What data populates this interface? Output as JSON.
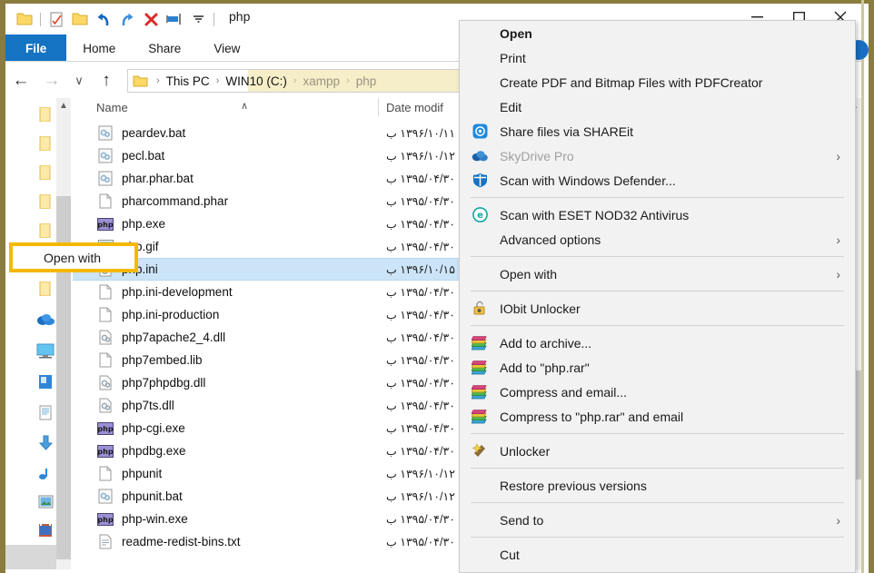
{
  "window": {
    "title": "php",
    "quick_access": [
      {
        "name": "folder-icon",
        "label": "Folder"
      },
      {
        "name": "properties-icon",
        "label": "Properties"
      },
      {
        "name": "new-folder-icon",
        "label": "New folder"
      },
      {
        "name": "undo-icon",
        "label": "Undo"
      },
      {
        "name": "redo-icon",
        "label": "Redo"
      },
      {
        "name": "delete-icon",
        "label": "Delete"
      },
      {
        "name": "rename-icon",
        "label": "Rename"
      },
      {
        "name": "customize-qat-icon",
        "label": "Customize Quick Access Toolbar"
      }
    ],
    "controls": {
      "minimize": "—",
      "maximize": "☐",
      "close": "✕"
    }
  },
  "ribbon": {
    "tabs": [
      {
        "label": "File",
        "active": true
      },
      {
        "label": "Home",
        "active": false
      },
      {
        "label": "Share",
        "active": false
      },
      {
        "label": "View",
        "active": false
      }
    ]
  },
  "address": {
    "back": "←",
    "forward": "→",
    "recent": "∨",
    "up": "↑",
    "crumbs": [
      {
        "label": "This PC",
        "dim": false
      },
      {
        "label": "WIN10 (C:)",
        "dim": false
      },
      {
        "label": "xampp",
        "dim": true
      },
      {
        "label": "php",
        "dim": true
      }
    ]
  },
  "nav_pane": {
    "items": [
      {
        "name": "folder-icon-1",
        "type": "folder"
      },
      {
        "name": "folder-icon-2",
        "type": "folder"
      },
      {
        "name": "folder-icon-3",
        "type": "folder"
      },
      {
        "name": "folder-icon-4",
        "type": "folder"
      },
      {
        "name": "folder-icon-5",
        "type": "folder"
      },
      {
        "name": "folder-icon-6",
        "type": "folder"
      },
      {
        "name": "folder-icon-7",
        "type": "folder"
      },
      {
        "name": "onedrive-icon",
        "type": "onedrive"
      },
      {
        "name": "this-pc-icon",
        "type": "monitor"
      },
      {
        "name": "drive-icon",
        "type": "drive"
      },
      {
        "name": "documents-icon",
        "type": "documents"
      },
      {
        "name": "downloads-icon",
        "type": "downloads"
      },
      {
        "name": "music-icon",
        "type": "music"
      },
      {
        "name": "pictures-icon",
        "type": "pictures"
      },
      {
        "name": "videos-icon",
        "type": "videos"
      }
    ]
  },
  "file_list": {
    "columns": {
      "name": "Name",
      "date_modified": "Date modif",
      "sort_indicator": "∧"
    },
    "rows": [
      {
        "name": "peardev.bat",
        "icon": "bat",
        "date": "۱۳۹۶/۱۰/۱۱ ب",
        "selected": false
      },
      {
        "name": "pecl.bat",
        "icon": "bat",
        "date": "۱۳۹۶/۱۰/۱۲ ب",
        "selected": false
      },
      {
        "name": "phar.phar.bat",
        "icon": "bat",
        "date": "۱۳۹۵/۰۴/۳۰ ب",
        "selected": false
      },
      {
        "name": "pharcommand.phar",
        "icon": "blank",
        "date": "۱۳۹۵/۰۴/۳۰ ب",
        "selected": false
      },
      {
        "name": "php.exe",
        "icon": "php",
        "date": "۱۳۹۵/۰۴/۳۰ ب",
        "selected": false
      },
      {
        "name": "php.gif",
        "icon": "gif",
        "date": "۱۳۹۵/۰۴/۳۰ ب",
        "selected": false
      },
      {
        "name": "php.ini",
        "icon": "ini",
        "date": "۱۳۹۶/۱۰/۱۵ ب",
        "selected": true
      },
      {
        "name": "php.ini-development",
        "icon": "blank",
        "date": "۱۳۹۵/۰۴/۳۰ ب",
        "selected": false
      },
      {
        "name": "php.ini-production",
        "icon": "blank",
        "date": "۱۳۹۵/۰۴/۳۰ ب",
        "selected": false
      },
      {
        "name": "php7apache2_4.dll",
        "icon": "dll",
        "date": "۱۳۹۵/۰۴/۳۰ ب",
        "selected": false
      },
      {
        "name": "php7embed.lib",
        "icon": "blank",
        "date": "۱۳۹۵/۰۴/۳۰ ب",
        "selected": false
      },
      {
        "name": "php7phpdbg.dll",
        "icon": "dll",
        "date": "۱۳۹۵/۰۴/۳۰ ب",
        "selected": false
      },
      {
        "name": "php7ts.dll",
        "icon": "dll",
        "date": "۱۳۹۵/۰۴/۳۰ ب",
        "selected": false
      },
      {
        "name": "php-cgi.exe",
        "icon": "php",
        "date": "۱۳۹۵/۰۴/۳۰ ب",
        "selected": false
      },
      {
        "name": "phpdbg.exe",
        "icon": "php",
        "date": "۱۳۹۵/۰۴/۳۰ ب",
        "selected": false
      },
      {
        "name": "phpunit",
        "icon": "blank",
        "date": "۱۳۹۶/۱۰/۱۲ ب",
        "selected": false
      },
      {
        "name": "phpunit.bat",
        "icon": "bat",
        "date": "۱۳۹۶/۱۰/۱۲ ب",
        "selected": false
      },
      {
        "name": "php-win.exe",
        "icon": "php",
        "date": "۱۳۹۵/۰۴/۳۰ ب",
        "selected": false
      },
      {
        "name": "readme-redist-bins.txt",
        "icon": "txt",
        "date": "۱۳۹۵/۰۴/۳۰ ب",
        "selected": false
      }
    ]
  },
  "context_menu": {
    "highlighted_item": "Open with",
    "highlight_color": "#f5b800",
    "items": [
      {
        "type": "item",
        "label": "Open",
        "icon": "none",
        "bold": true,
        "arrow": false
      },
      {
        "type": "item",
        "label": "Print",
        "icon": "none",
        "bold": false,
        "arrow": false
      },
      {
        "type": "item",
        "label": "Create PDF and Bitmap Files with PDFCreator",
        "icon": "none",
        "bold": false,
        "arrow": false
      },
      {
        "type": "item",
        "label": "Edit",
        "icon": "none",
        "bold": false,
        "arrow": false
      },
      {
        "type": "item",
        "label": "Share files via SHAREit",
        "icon": "shareit",
        "bold": false,
        "arrow": false
      },
      {
        "type": "item",
        "label": "SkyDrive Pro",
        "icon": "skydrive",
        "bold": false,
        "arrow": true,
        "disabled": true
      },
      {
        "type": "item",
        "label": "Scan with Windows Defender...",
        "icon": "defender",
        "bold": false,
        "arrow": false
      },
      {
        "type": "sep"
      },
      {
        "type": "item",
        "label": "Scan with ESET NOD32 Antivirus",
        "icon": "eset",
        "bold": false,
        "arrow": false
      },
      {
        "type": "item",
        "label": "Advanced options",
        "icon": "none",
        "bold": false,
        "arrow": true
      },
      {
        "type": "sep"
      },
      {
        "type": "item",
        "label": "Open with",
        "icon": "none",
        "bold": false,
        "arrow": true
      },
      {
        "type": "sep"
      },
      {
        "type": "item",
        "label": "IObit Unlocker",
        "icon": "iobit",
        "bold": false,
        "arrow": false
      },
      {
        "type": "sep"
      },
      {
        "type": "item",
        "label": "Add to archive...",
        "icon": "winrar",
        "bold": false,
        "arrow": false
      },
      {
        "type": "item",
        "label": "Add to \"php.rar\"",
        "icon": "winrar",
        "bold": false,
        "arrow": false
      },
      {
        "type": "item",
        "label": "Compress and email...",
        "icon": "winrar",
        "bold": false,
        "arrow": false
      },
      {
        "type": "item",
        "label": "Compress to \"php.rar\" and email",
        "icon": "winrar",
        "bold": false,
        "arrow": false
      },
      {
        "type": "sep"
      },
      {
        "type": "item",
        "label": "Unlocker",
        "icon": "unlocker",
        "bold": false,
        "arrow": false
      },
      {
        "type": "sep"
      },
      {
        "type": "item",
        "label": "Restore previous versions",
        "icon": "none",
        "bold": false,
        "arrow": false
      },
      {
        "type": "sep"
      },
      {
        "type": "item",
        "label": "Send to",
        "icon": "none",
        "bold": false,
        "arrow": true
      },
      {
        "type": "sep"
      },
      {
        "type": "item",
        "label": "Cut",
        "icon": "none",
        "bold": false,
        "arrow": false
      }
    ]
  }
}
